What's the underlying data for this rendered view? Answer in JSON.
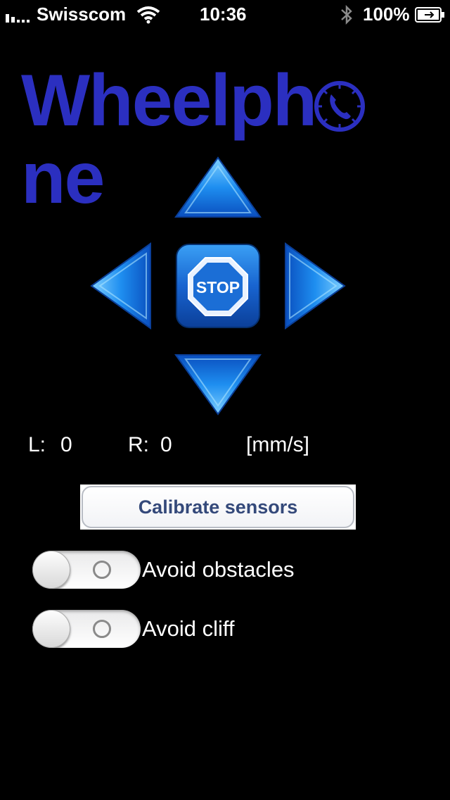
{
  "status_bar": {
    "carrier": "Swisscom",
    "time": "10:36",
    "battery_percent": "100%",
    "icons": [
      "signal-icon",
      "wifi-icon",
      "bluetooth-icon",
      "battery-icon"
    ]
  },
  "logo": {
    "text_before": "Wheelph",
    "text_after": "ne",
    "color": "#2b2fc0",
    "icon": "phone-clock-icon"
  },
  "controls": {
    "forward": "arrow-up-icon",
    "left": "arrow-left-icon",
    "right": "arrow-right-icon",
    "backward": "arrow-down-icon",
    "stop_label": "STOP"
  },
  "speed": {
    "left_label": "L:",
    "left_value": "0",
    "right_label": "R:",
    "right_value": "0",
    "unit": "[mm/s]"
  },
  "calibrate_button": "Calibrate sensors",
  "toggles": [
    {
      "label": "Avoid obstacles",
      "on": false
    },
    {
      "label": "Avoid cliff",
      "on": false
    }
  ]
}
